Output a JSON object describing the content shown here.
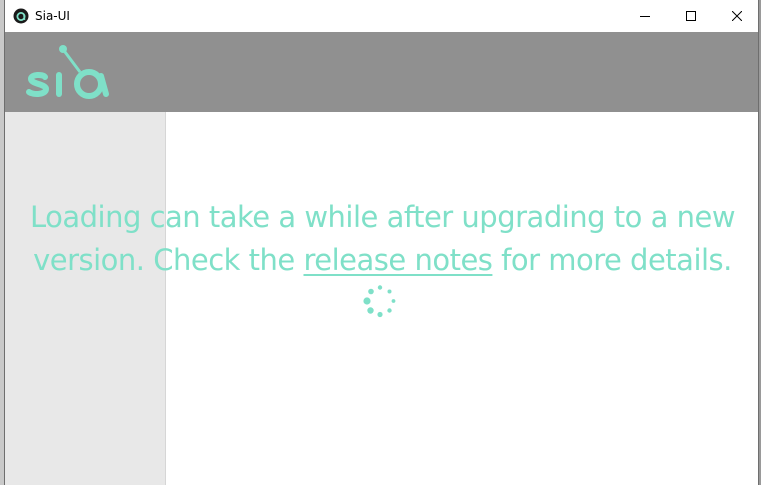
{
  "window": {
    "title": "Sia-UI"
  },
  "colors": {
    "header_bg": "#909090",
    "sidebar_bg": "#e8e8e8",
    "accent": "#7fe0c8"
  },
  "header": {
    "logo_text": "sia"
  },
  "loading": {
    "before_link": "Loading can take a while after upgrading to a new version. Check the ",
    "link_text": "release notes",
    "after_link": " for more details."
  },
  "icons": {
    "app": "sia-app-icon",
    "minimize": "minimize-icon",
    "maximize": "maximize-icon",
    "close": "close-icon",
    "spinner": "loading-spinner-icon"
  }
}
